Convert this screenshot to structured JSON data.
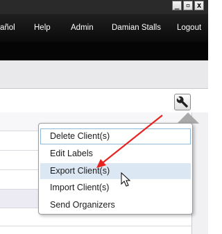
{
  "window": {
    "minimize_glyph": "_",
    "restore_glyph": "▫",
    "close_glyph": "x"
  },
  "nav": {
    "language": "añol",
    "help": "Help",
    "admin": "Admin",
    "user": "Damian Stalls",
    "logout": "Logout"
  },
  "tools_menu": {
    "trigger_icon": "wrench-icon",
    "items": [
      {
        "label": "Delete Client(s)",
        "state": "focused"
      },
      {
        "label": "Edit Labels"
      },
      {
        "label": "Export Client(s)",
        "state": "hover"
      },
      {
        "label": "Import Client(s)"
      },
      {
        "label": "Send Organizers"
      }
    ]
  },
  "annotation": {
    "arrow_color": "#e8231f",
    "cursor": "mouse-pointer-icon"
  }
}
